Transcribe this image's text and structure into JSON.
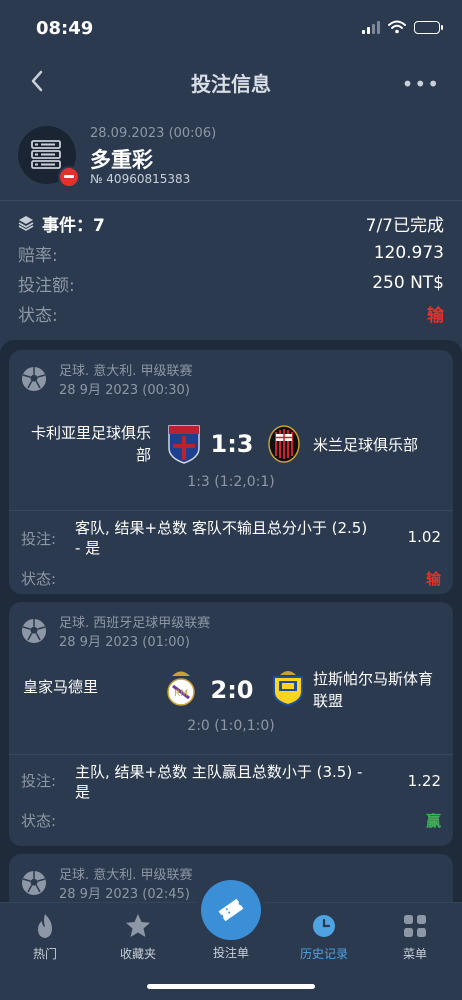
{
  "status_bar": {
    "time": "08:49"
  },
  "nav": {
    "title": "投注信息"
  },
  "bet": {
    "date": "28.09.2023 (00:06)",
    "type": "多重彩",
    "number": "№ 40960815383"
  },
  "summary": {
    "events_label": "事件：7",
    "events_value": "7/7已完成",
    "odds_label": "赔率:",
    "odds_value": "120.973",
    "stake_label": "投注额:",
    "stake_value": "250 NT$",
    "status_label": "状态:",
    "status_value": "输"
  },
  "matches": [
    {
      "league": "足球. 意大利. 甲级联赛",
      "date": "28 9月 2023 (00:30)",
      "home": "卡利亚里足球俱乐部",
      "away": "米兰足球俱乐部",
      "score": "1:3",
      "score_detail": "1:3 (1:2,0:1)",
      "bet_label": "投注:",
      "bet_desc": "客队, 结果+总数 客队不输且总分小于 (2.5) - 是",
      "odd": "1.02",
      "status_label": "状态:",
      "status": "输"
    },
    {
      "league": "足球. 西班牙足球甲级联赛",
      "date": "28 9月 2023 (01:00)",
      "home": "皇家马德里",
      "away": "拉斯帕尔马斯体育联盟",
      "score": "2:0",
      "score_detail": "2:0 (1:0,1:0)",
      "bet_label": "投注:",
      "bet_desc": "主队, 结果+总数 主队赢且总数小于 (3.5) - 是",
      "odd": "1.22",
      "status_label": "状态:",
      "status": "赢"
    },
    {
      "league": "足球. 意大利. 甲级联赛",
      "date": "28 9月 2023 (02:45)"
    }
  ],
  "tabbar": {
    "hot": "热门",
    "favorites": "收藏夹",
    "betslip": "投注单",
    "history": "历史记录",
    "menu": "菜单"
  },
  "colors": {
    "accent": "#3a8fd6",
    "lose": "#e4312b",
    "win": "#3fae5a",
    "background": "#2b3a4f"
  }
}
